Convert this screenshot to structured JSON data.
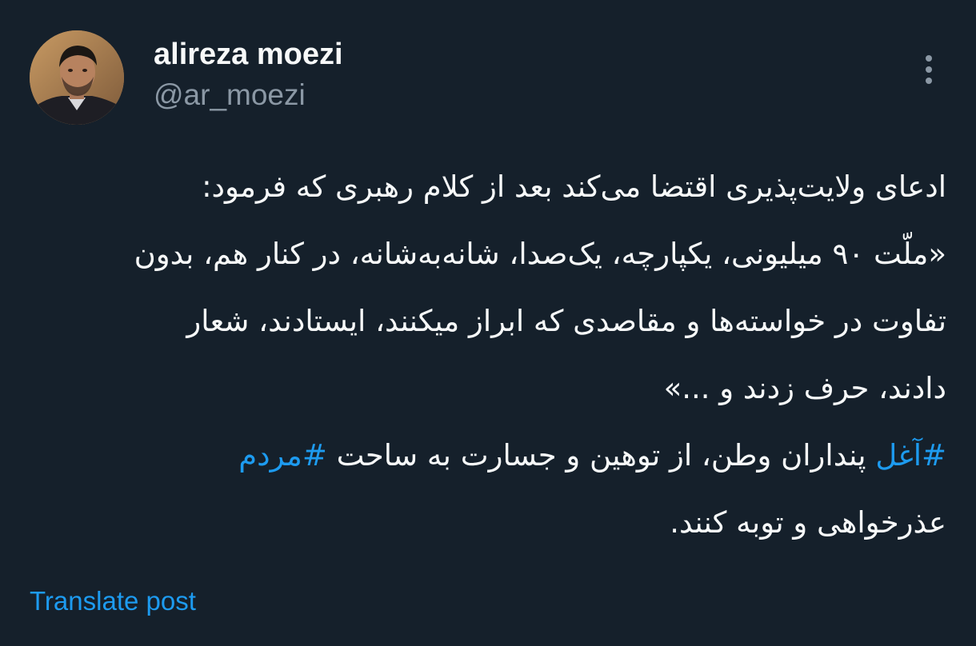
{
  "author": {
    "display_name": "alireza moezi",
    "handle": "@ar_moezi",
    "avatar_icon": "profile-photo"
  },
  "menu": {
    "more_icon": "more-vertical-icon"
  },
  "post": {
    "lines": [
      "ادعای ولایت‌پذیری اقتضا می‌کند بعد از کلام رهبری که فرمود:",
      "«ملّت ۹۰ میلیونی، یکپارچه، یک‌صدا، شانه‌به‌شانه، در کنار هم، بدون",
      "تفاوت در خواسته‌ها و مقاصدی که ابراز میکنند، ایستادند، شعار",
      "دادند، حرف زدند و ...»"
    ],
    "line5": {
      "hashtag1": "#آغل",
      "middle": " پنداران وطن، از توهین و جسارت به ساحت ",
      "hashtag2": "#مردم"
    },
    "line6": "عذرخواهی و توبه کنند."
  },
  "actions": {
    "translate_label": "Translate post"
  },
  "colors": {
    "background": "#15202b",
    "text": "#f7f9f9",
    "secondary_text": "#8b98a5",
    "link": "#1d9bf0"
  }
}
